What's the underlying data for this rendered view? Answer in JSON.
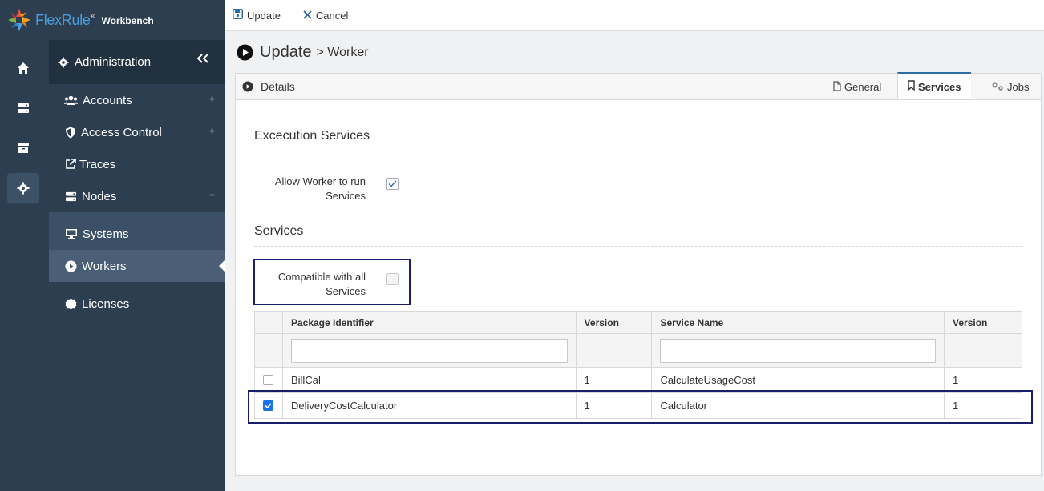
{
  "brand": {
    "name": "FlexRule",
    "reg": "®",
    "product": "Workbench"
  },
  "sidebar": {
    "header": "Administration",
    "items": [
      {
        "label": "Accounts",
        "icon": "users-icon",
        "expand": "plus"
      },
      {
        "label": "Access Control",
        "icon": "shield-icon",
        "expand": "plus"
      },
      {
        "label": "Traces",
        "icon": "external-link-icon"
      },
      {
        "label": "Nodes",
        "icon": "server-icon",
        "expand": "minus"
      },
      {
        "label": "Systems",
        "icon": "monitor-icon"
      },
      {
        "label": "Workers",
        "icon": "play-circle-icon",
        "active": true
      },
      {
        "label": "Licenses",
        "icon": "badge-icon"
      }
    ]
  },
  "toolbar": {
    "update_label": "Update",
    "cancel_label": "Cancel"
  },
  "page": {
    "title": "Update",
    "subtitle": "> Worker"
  },
  "panel": {
    "details_label": "Details",
    "tabs": [
      {
        "label": "General",
        "icon": "file-icon"
      },
      {
        "label": "Services",
        "icon": "bookmark-icon",
        "active": true
      },
      {
        "label": "Jobs",
        "icon": "cogs-icon"
      }
    ]
  },
  "execution": {
    "title": "Excecution Services",
    "allow_label_line1": "Allow Worker to run",
    "allow_label_line2": "Services",
    "allow_checked": true
  },
  "services": {
    "title": "Services",
    "compat_label_line1": "Compatible with all",
    "compat_label_line2": "Services",
    "compat_checked": false
  },
  "grid": {
    "headers": [
      "Package Identifier",
      "Version",
      "Service Name",
      "Version"
    ],
    "rows": [
      {
        "checked": false,
        "package": "BillCal",
        "version": "1",
        "service": "CalculateUsageCost",
        "service_version": "1"
      },
      {
        "checked": true,
        "package": "DeliveryCostCalculator",
        "version": "1",
        "service": "Calculator",
        "service_version": "1"
      }
    ]
  },
  "colors": {
    "sidebar": "#2c3e50",
    "accent": "#1a73e8",
    "highlight": "#1a1d6b",
    "brand": "#4a9edb"
  }
}
